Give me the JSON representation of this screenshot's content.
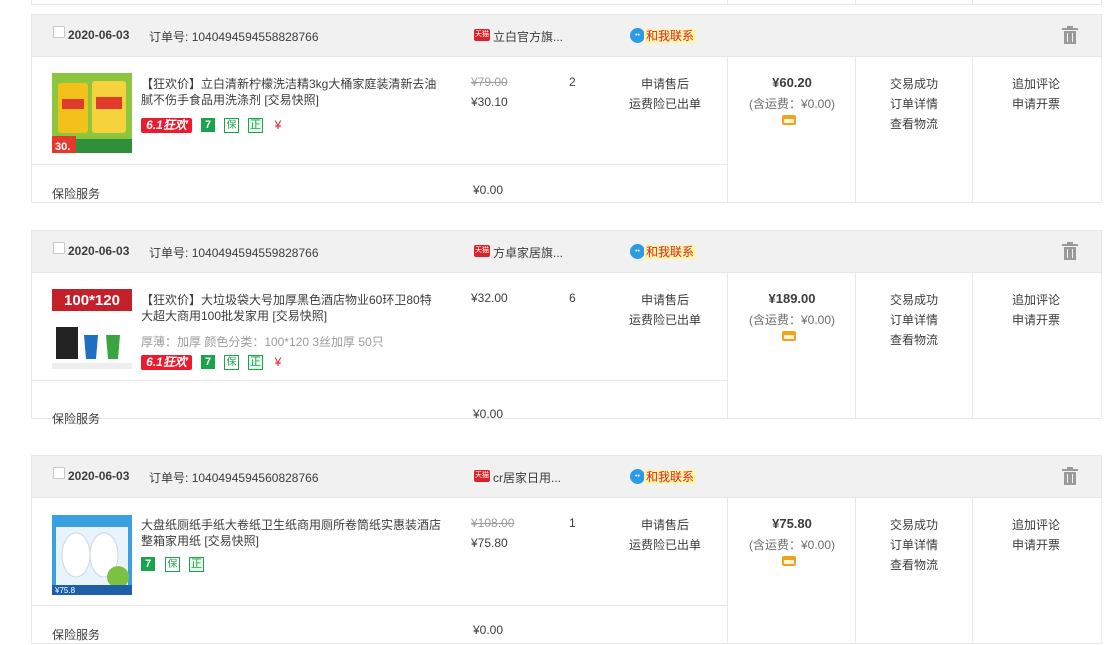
{
  "orders": [
    {
      "date": "2020-06-03",
      "order_label": "订单号:",
      "order_no": "1040494594558828766",
      "shop_badge": "天猫",
      "shop": "立白官方旗...",
      "contact": "和我联系",
      "title": "【狂欢价】立白清新柠檬洗洁精3kg大桶家庭装清新去油腻不伤手食品用洗涤剂 [交易快照]",
      "spec": "",
      "badges": [
        "6.1狂欢",
        "7",
        "保",
        "正",
        "¥"
      ],
      "old_price": "¥79.00",
      "price": "¥30.10",
      "qty": "2",
      "after_sale": "申请售后",
      "insurance_note": "运费险已出单",
      "total": "¥60.20",
      "shipping": "(含运费：¥0.00)",
      "status": [
        "交易成功",
        "订单详情",
        "查看物流"
      ],
      "actions": [
        "追加评论",
        "申请开票"
      ],
      "service": "保险服务",
      "service_price": "¥0.00",
      "thumb_text": "30.",
      "thumb_color": "#f2c21b"
    },
    {
      "date": "2020-06-03",
      "order_label": "订单号:",
      "order_no": "1040494594559828766",
      "shop_badge": "天猫",
      "shop": "方卓家居旗...",
      "contact": "和我联系",
      "title": "【狂欢价】大垃圾袋大号加厚黑色酒店物业60环卫80特大超大商用100批发家用 [交易快照]",
      "spec": "厚薄：加厚  颜色分类：100*120 3丝加厚 50只",
      "badges": [
        "6.1狂欢",
        "7",
        "保",
        "正",
        "¥"
      ],
      "old_price": "",
      "price": "¥32.00",
      "qty": "6",
      "after_sale": "申请售后",
      "insurance_note": "运费险已出单",
      "total": "¥189.00",
      "shipping": "(含运费：¥0.00)",
      "status": [
        "交易成功",
        "订单详情",
        "查看物流"
      ],
      "actions": [
        "追加评论",
        "申请开票"
      ],
      "service": "保险服务",
      "service_price": "¥0.00",
      "thumb_text": "100*120",
      "thumb_color": "#c3202a"
    },
    {
      "date": "2020-06-03",
      "order_label": "订单号:",
      "order_no": "1040494594560828766",
      "shop_badge": "天猫",
      "shop": "cr居家日用...",
      "contact": "和我联系",
      "title": "大盘纸厕纸手纸大卷纸卫生纸商用厕所卷筒纸实惠装酒店整箱家用纸 [交易快照]",
      "spec": "",
      "badges": [
        "7",
        "保",
        "正"
      ],
      "old_price": "¥108.00",
      "price": "¥75.80",
      "qty": "1",
      "after_sale": "申请售后",
      "insurance_note": "运费险已出单",
      "total": "¥75.80",
      "shipping": "(含运费：¥0.00)",
      "status": [
        "交易成功",
        "订单详情",
        "查看物流"
      ],
      "actions": [
        "追加评论",
        "申请开票"
      ],
      "service": "保险服务",
      "service_price": "¥0.00",
      "thumb_text": "¥75.8",
      "thumb_color": "#3aa0e0"
    }
  ]
}
